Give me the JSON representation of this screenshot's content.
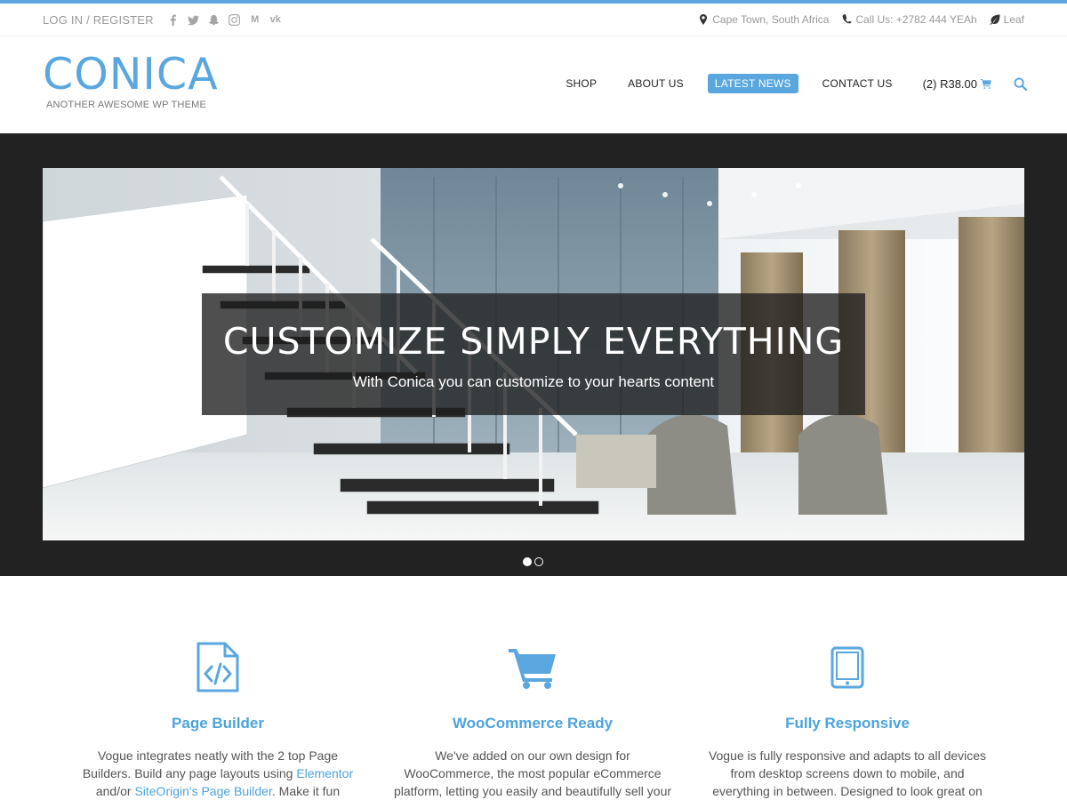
{
  "topbar": {
    "login_label": "LOG IN / REGISTER",
    "social_icons": [
      "facebook-icon",
      "twitter-icon",
      "snapchat-icon",
      "instagram-icon",
      "medium-icon",
      "vk-icon"
    ],
    "medium_text": "M",
    "vk_text": "vk",
    "location": "Cape Town, South Africa",
    "phone": "Call Us: +2782 444 YEAh",
    "leaf": "Leaf"
  },
  "header": {
    "logo_title": "CONICA",
    "logo_tagline": "ANOTHER AWESOME WP THEME"
  },
  "nav": {
    "items": [
      "SHOP",
      "ABOUT US",
      "LATEST NEWS",
      "CONTACT US"
    ],
    "active": "LATEST NEWS",
    "cart_label": "(2) R38.00"
  },
  "slider": {
    "title": "CUSTOMIZE SIMPLY EVERYTHING",
    "subtitle": "With Conica you can customize to your hearts content",
    "slide_count": 2,
    "active_slide": 1
  },
  "features": [
    {
      "icon": "code-file-icon",
      "title": "Page Builder",
      "text_before": "Vogue integrates neatly with the 2 top Page Builders. Build any page layouts using ",
      "link1": "Elementor",
      "text_mid": " and/or ",
      "link2": "SiteOrigin's Page Builder",
      "text_after": ". Make it fun building your website."
    },
    {
      "icon": "shopping-cart-icon",
      "title": "WooCommerce Ready",
      "text": "We've added on our own design for WooCommerce, the most popular eCommerce platform, letting you easily and beautifully sell your products online."
    },
    {
      "icon": "tablet-icon",
      "title": "Fully Responsive",
      "text": "Vogue is fully responsive and adapts to all devices from desktop screens down to mobile, and everything in between. Designed to look great on any device."
    }
  ],
  "colors": {
    "accent": "#5aa7e0",
    "dark": "#222222"
  }
}
